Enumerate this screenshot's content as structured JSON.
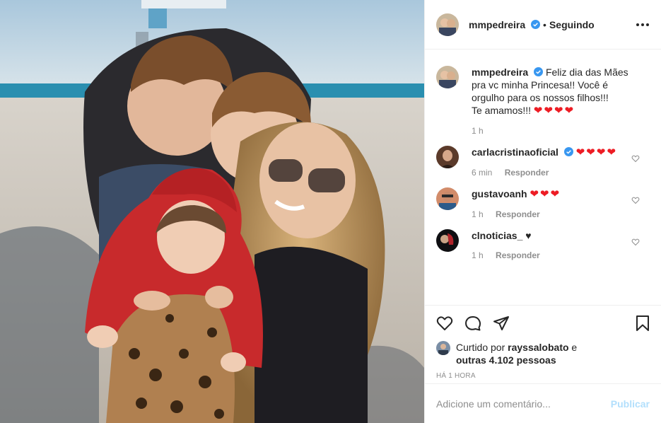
{
  "post": {
    "image_alt": "",
    "author": "mmpedreira",
    "follow_status": "Seguindo",
    "separator": "•"
  },
  "caption": {
    "user": "mmpedreira",
    "text_line1": "Feliz dia das Mães pra vc minha Princesa!! Você é orgulho para os nossos filhos!!!",
    "text_line2": "Te amamos!!!",
    "hearts": "❤❤❤❤",
    "time": "1 h"
  },
  "comments": [
    {
      "user": "carlacristinaoficial",
      "verified": true,
      "text": "❤❤❤❤",
      "time": "6 min",
      "reply": "Responder"
    },
    {
      "user": "gustavoanh",
      "verified": false,
      "text": "❤❤❤",
      "time": "1 h",
      "reply": "Responder"
    },
    {
      "user": "clnoticias_",
      "verified": false,
      "text": "♥",
      "time": "1 h",
      "reply": "Responder"
    }
  ],
  "likes": {
    "prefix": "Curtido por",
    "user": "rayssalobato",
    "connector": "e",
    "others": "outras 4.102 pessoas"
  },
  "timestamp": "HÁ 1 HORA",
  "add_comment": {
    "placeholder": "Adicione um comentário...",
    "publish": "Publicar"
  },
  "colors": {
    "verified": "#3897f0",
    "heart": "#ed1c24",
    "publish_disabled": "#b2dffc",
    "meta_gray": "#8e8e8e"
  }
}
